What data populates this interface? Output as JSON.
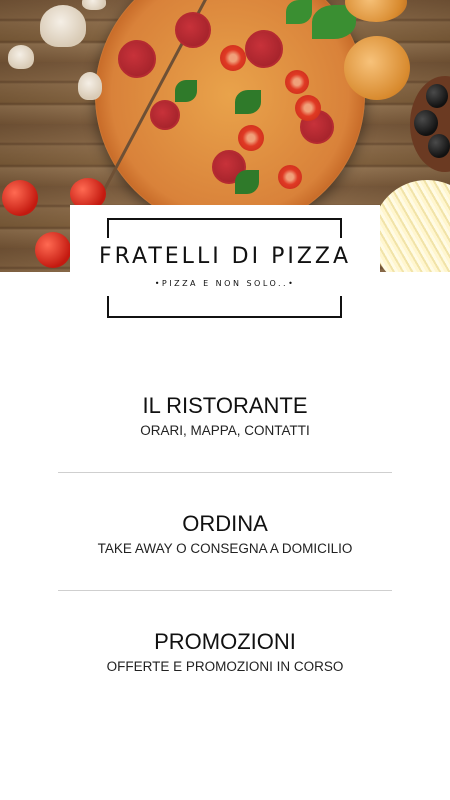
{
  "logo": {
    "title": "FRATELLI DI PIZZA",
    "tagline": "•PIZZA E NON SOLO..•"
  },
  "menu": {
    "items": [
      {
        "title": "IL RISTORANTE",
        "subtitle": "ORARI, MAPPA, CONTATTI"
      },
      {
        "title": "ORDINA",
        "subtitle": "TAKE AWAY O CONSEGNA A DOMICILIO"
      },
      {
        "title": "PROMOZIONI",
        "subtitle": "OFFERTE E PROMOZIONI IN CORSO"
      }
    ]
  },
  "colors": {
    "background": "#ffffff",
    "text": "#111111",
    "divider": "#cfcfcf"
  }
}
